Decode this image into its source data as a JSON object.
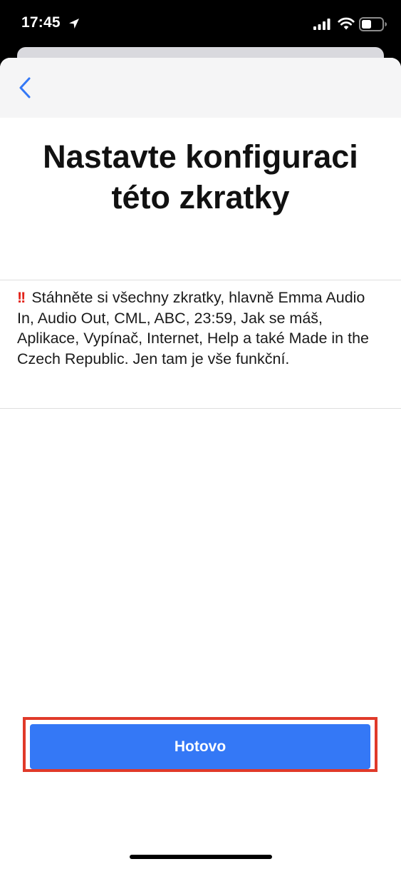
{
  "status_bar": {
    "time": "17:45",
    "icons": [
      "location-arrow-icon",
      "cellular-signal-icon",
      "wifi-icon",
      "battery-icon"
    ]
  },
  "nav": {
    "back_icon": "chevron-left-icon",
    "accent_color": "#3478f6"
  },
  "title": {
    "line1": "Nastavte konfiguraci",
    "line2": "této zkratky"
  },
  "description": {
    "icon": "double-exclamation-icon",
    "icon_glyph": "!!",
    "text": "Stáhněte si všechny zkratky, hlavně Emma Audio In, Audio Out, CML, ABC, 23:59, Jak se máš, Aplikace, Vypínač, Internet, Help a také Made in the Czech Republic. Jen tam je vše funkční."
  },
  "done_button": {
    "label": "Hotovo",
    "background": "#3478f6",
    "highlight_color": "#e03a2a"
  }
}
